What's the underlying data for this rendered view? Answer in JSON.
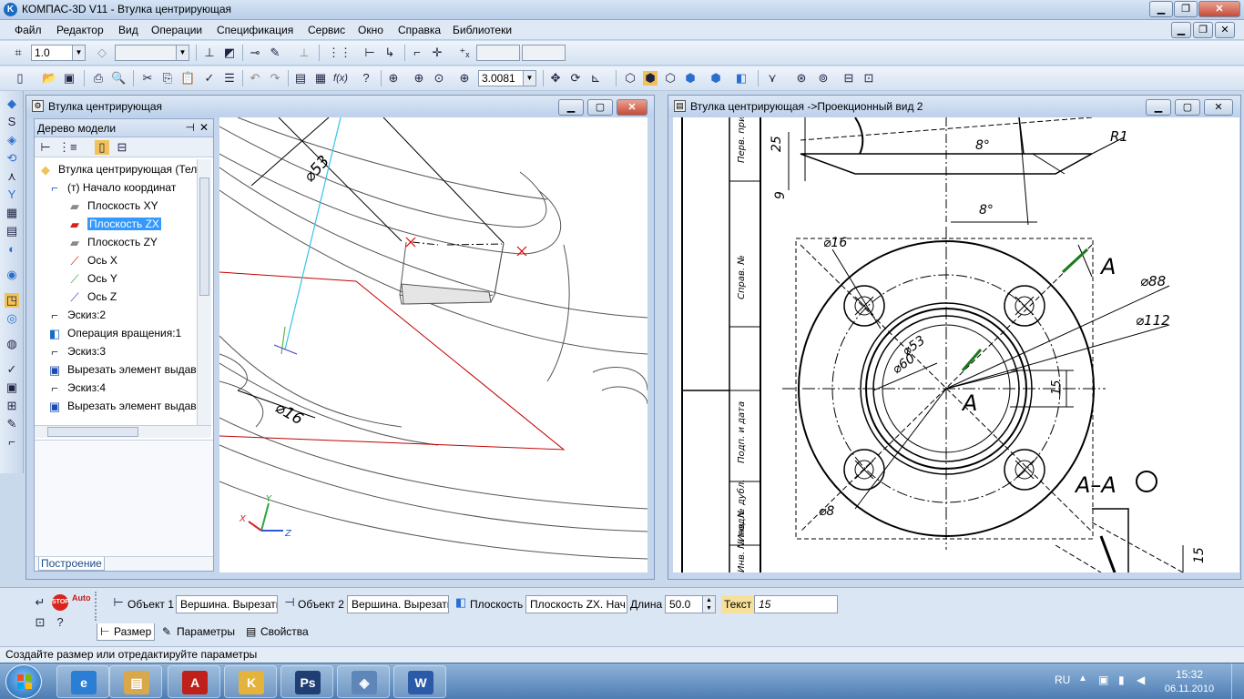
{
  "app": {
    "title": "КОМПАС-3D V11 - Втулка центрирующая",
    "icon": "kompas-logo-icon"
  },
  "menu": [
    "Файл",
    "Редактор",
    "Вид",
    "Операции",
    "Спецификация",
    "Сервис",
    "Окно",
    "Справка",
    "Библиотеки"
  ],
  "toolbar1": {
    "step_value": "1.0",
    "layer_value": ""
  },
  "toolbar2": {
    "zoom_value": "3.0081"
  },
  "window3d": {
    "title": "Втулка центрирующая"
  },
  "window2d": {
    "title": "Втулка центрирующая ->Проекционный вид 2"
  },
  "tree": {
    "header": "Дерево модели",
    "items": [
      {
        "label": "Втулка центрирующая (Тел-",
        "icon": "part-icon"
      },
      {
        "label": "(т) Начало координат",
        "icon": "origin-icon"
      },
      {
        "label": "Плоскость XY",
        "icon": "plane-icon"
      },
      {
        "label": "Плоскость ZX",
        "icon": "plane-red-icon",
        "selected": true
      },
      {
        "label": "Плоскость ZY",
        "icon": "plane-icon"
      },
      {
        "label": "Ось X",
        "icon": "axis-red-icon"
      },
      {
        "label": "Ось Y",
        "icon": "axis-green-icon"
      },
      {
        "label": "Ось Z",
        "icon": "axis-purple-icon"
      },
      {
        "label": "Эскиз:2",
        "icon": "sketch-icon"
      },
      {
        "label": "Операция вращения:1",
        "icon": "revolve-icon"
      },
      {
        "label": "Эскиз:3",
        "icon": "sketch-icon"
      },
      {
        "label": "Вырезать элемент выдав",
        "icon": "cut-extrude-icon"
      },
      {
        "label": "Эскиз:4",
        "icon": "sketch-icon"
      },
      {
        "label": "Вырезать элемент выдав",
        "icon": "cut-extrude-icon"
      }
    ],
    "footer_tab": "Построение"
  },
  "view3d": {
    "dim_53": "⌀53",
    "dim_16": "⌀16",
    "axis_x": "X",
    "axis_y": "Y",
    "axis_z": "Z"
  },
  "drawing": {
    "dims": {
      "d25": "25",
      "d9": "9",
      "ang8a": "8°",
      "ang8b": "8°",
      "r1": "R1",
      "d16": "⌀16",
      "d88": "⌀88",
      "d112": "⌀112",
      "d53": "⌀53",
      "d60": "⌀60",
      "d8": "⌀8",
      "d15": "15",
      "d15b": "15"
    },
    "section_letter": "A",
    "section_letter2": "A",
    "section_label": "A–A",
    "stamp": [
      "Инв. № подл.",
      "Подп. и дата",
      "Справ. №",
      "Перв. примен.",
      "Подп. и дата",
      "Инв. № дубл."
    ]
  },
  "props": {
    "obj1_label": "Объект 1",
    "obj1_value": "Вершина. Вырезать",
    "obj2_label": "Объект 2",
    "obj2_value": "Вершина. Вырезать",
    "plane_label": "Плоскость",
    "plane_value": "Плоскость ZX. Нач",
    "length_label": "Длина",
    "length_value": "50.0",
    "text_label": "Текст",
    "text_value": "15",
    "tabs": [
      "Размер",
      "Параметры",
      "Свойства"
    ],
    "auto_label": "Auto",
    "stop_label": "STOP"
  },
  "status": "Создайте размер или отредактируйте параметры",
  "taskbar": {
    "apps": [
      {
        "name": "ie",
        "glyph": "e",
        "color": "#2a7fd4"
      },
      {
        "name": "explorer",
        "glyph": "▤",
        "color": "#d9a84a"
      },
      {
        "name": "acrobat",
        "glyph": "A",
        "color": "#c0201a"
      },
      {
        "name": "kompas",
        "glyph": "K",
        "color": "#e3b33c"
      },
      {
        "name": "photoshop",
        "glyph": "Ps",
        "color": "#1f3f74"
      },
      {
        "name": "kompas3d",
        "glyph": "◈",
        "color": "#5f86b8"
      },
      {
        "name": "word",
        "glyph": "W",
        "color": "#2b5aa8"
      }
    ],
    "lang": "RU",
    "time": "15:32",
    "date": "06.11.2010"
  }
}
